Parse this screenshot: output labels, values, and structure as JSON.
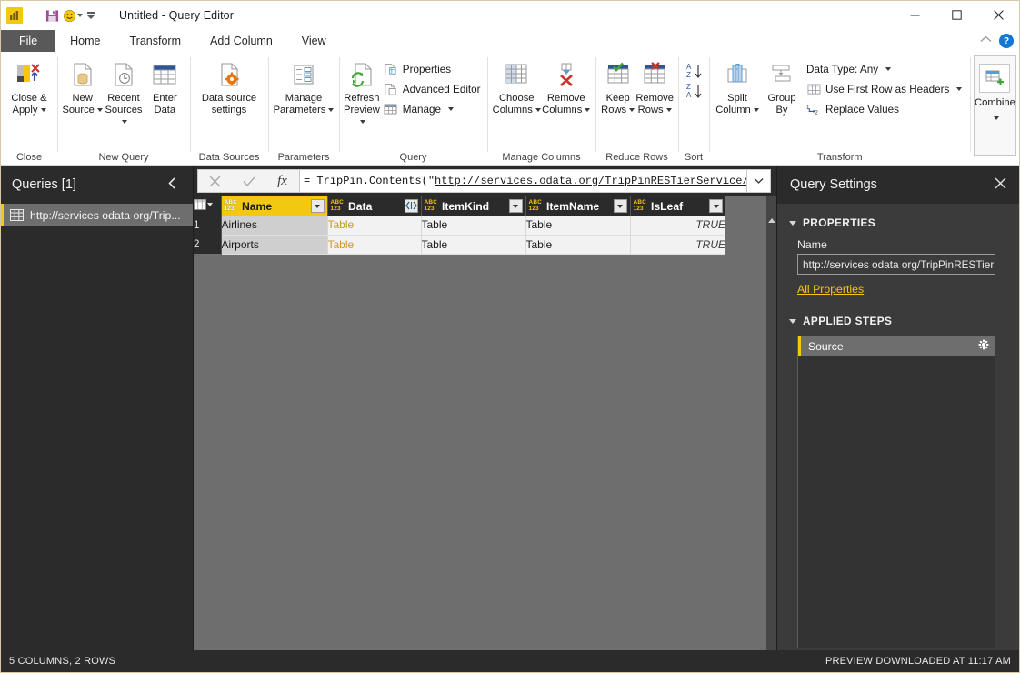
{
  "window": {
    "title": "Untitled - Query Editor",
    "app_icon": "powerbi-icon",
    "save_icon": "save-icon",
    "smiley_icon": "smiley-icon",
    "minimize": "—",
    "maximize": "☐",
    "close": "✕",
    "collapse_ribbon": "⌃",
    "help": "?"
  },
  "ribbon": {
    "tabs": [
      {
        "label": "File",
        "id": "file"
      },
      {
        "label": "Home",
        "id": "home"
      },
      {
        "label": "Transform",
        "id": "transform"
      },
      {
        "label": "Add Column",
        "id": "add-column"
      },
      {
        "label": "View",
        "id": "view"
      }
    ],
    "active_tab": "Home",
    "groups": [
      {
        "name": "Close",
        "label": "Close",
        "buttons": [
          {
            "label": "Close &\nApply",
            "icon": "close-apply-icon",
            "has_caret": true
          }
        ]
      },
      {
        "name": "New Query",
        "label": "New Query",
        "buttons": [
          {
            "label": "New\nSource",
            "icon": "new-source-icon",
            "has_caret": true
          },
          {
            "label": "Recent\nSources",
            "icon": "recent-sources-icon",
            "has_caret": true
          },
          {
            "label": "Enter\nData",
            "icon": "enter-data-icon",
            "has_caret": false
          }
        ]
      },
      {
        "name": "Data Sources",
        "label": "Data Sources",
        "buttons": [
          {
            "label": "Data source\nsettings",
            "icon": "data-source-settings-icon",
            "has_caret": false
          }
        ]
      },
      {
        "name": "Parameters",
        "label": "Parameters",
        "buttons": [
          {
            "label": "Manage\nParameters",
            "icon": "manage-parameters-icon",
            "has_caret": true
          }
        ]
      },
      {
        "name": "Query",
        "label": "Query",
        "buttons": [
          {
            "label": "Refresh\nPreview",
            "icon": "refresh-preview-icon",
            "has_caret": true
          }
        ],
        "small_buttons": [
          {
            "label": "Properties",
            "icon": "properties-icon",
            "has_caret": false
          },
          {
            "label": "Advanced Editor",
            "icon": "advanced-editor-icon",
            "has_caret": false
          },
          {
            "label": "Manage",
            "icon": "manage-icon",
            "has_caret": true
          }
        ]
      },
      {
        "name": "Manage Columns",
        "label": "Manage Columns",
        "buttons": [
          {
            "label": "Choose\nColumns",
            "icon": "choose-columns-icon",
            "has_caret": true
          },
          {
            "label": "Remove\nColumns",
            "icon": "remove-columns-icon",
            "has_caret": true
          }
        ]
      },
      {
        "name": "Reduce Rows",
        "label": "Reduce Rows",
        "buttons": [
          {
            "label": "Keep\nRows",
            "icon": "keep-rows-icon",
            "has_caret": true
          },
          {
            "label": "Remove\nRows",
            "icon": "remove-rows-icon",
            "has_caret": true
          }
        ]
      },
      {
        "name": "Sort",
        "label": "Sort",
        "small_buttons": [
          {
            "label": "",
            "icon": "sort-ascending-icon",
            "has_caret": false
          },
          {
            "label": "",
            "icon": "sort-descending-icon",
            "has_caret": false
          }
        ]
      },
      {
        "name": "Transform",
        "label": "Transform",
        "buttons": [
          {
            "label": "Split\nColumn",
            "icon": "split-column-icon",
            "has_caret": true
          },
          {
            "label": "Group\nBy",
            "icon": "group-by-icon",
            "has_caret": false
          }
        ],
        "small_buttons": [
          {
            "label": "Data Type: Any",
            "icon": "data-type-icon",
            "has_caret": true
          },
          {
            "label": "Use First Row as Headers",
            "icon": "first-row-headers-icon",
            "has_caret": true
          },
          {
            "label": "Replace Values",
            "icon": "replace-values-icon",
            "has_caret": false
          }
        ]
      },
      {
        "name": "Combine",
        "label": "",
        "buttons": [
          {
            "label": "Combine",
            "icon": "combine-icon",
            "has_caret": true
          }
        ]
      }
    ]
  },
  "queries_pane": {
    "header": "Queries [1]",
    "collapse_icon": "chevron-left-icon",
    "items": [
      {
        "label": "http://services odata org/Trip...",
        "icon": "table-icon",
        "selected": true
      }
    ]
  },
  "formula_bar": {
    "cancel_icon": "✕",
    "accept_icon": "✓",
    "fx_icon": "fx",
    "prefix": "= TripPin.Contents(\"",
    "link": "http://services.odata.org/TripPinRESTierService/(S",
    "full_value": "= TripPin.Contents(\"http://services.odata.org/TripPinRESTierService/(S",
    "expand_icon": "⌄"
  },
  "grid": {
    "columns": [
      {
        "name": "Name",
        "type_icon": "ABC\n123",
        "button": "filter",
        "selected": true
      },
      {
        "name": "Data",
        "type_icon": "ABC\n123",
        "button": "expand",
        "selected": false
      },
      {
        "name": "ItemKind",
        "type_icon": "ABC\n123",
        "button": "filter",
        "selected": false
      },
      {
        "name": "ItemName",
        "type_icon": "ABC\n123",
        "button": "filter",
        "selected": false
      },
      {
        "name": "IsLeaf",
        "type_icon": "ABC\n123",
        "button": "filter",
        "selected": false
      }
    ],
    "rows": [
      {
        "num": "1",
        "cells": [
          "Airlines",
          "Table",
          "Table",
          "Table",
          "TRUE"
        ]
      },
      {
        "num": "2",
        "cells": [
          "Airports",
          "Table",
          "Table",
          "Table",
          "TRUE"
        ]
      }
    ]
  },
  "query_settings": {
    "header": "Query Settings",
    "close_icon": "✕",
    "properties_section": "PROPERTIES",
    "name_label": "Name",
    "name_value": "http://services odata org/TripPinRESTierS",
    "all_properties_link": "All Properties",
    "applied_steps_section": "APPLIED STEPS",
    "steps": [
      {
        "label": "Source",
        "gear_icon": "gear-icon",
        "selected": true
      }
    ]
  },
  "statusbar": {
    "left": "5 COLUMNS, 2 ROWS",
    "right": "PREVIEW DOWNLOADED AT 11:17 AM"
  },
  "colors": {
    "accent_yellow": "#f2c811",
    "dark_panel": "#2b2b2b",
    "mid_panel": "#3b3b3b",
    "grid_bg": "#6e6e6e",
    "link_orange": "#c59a2a"
  }
}
